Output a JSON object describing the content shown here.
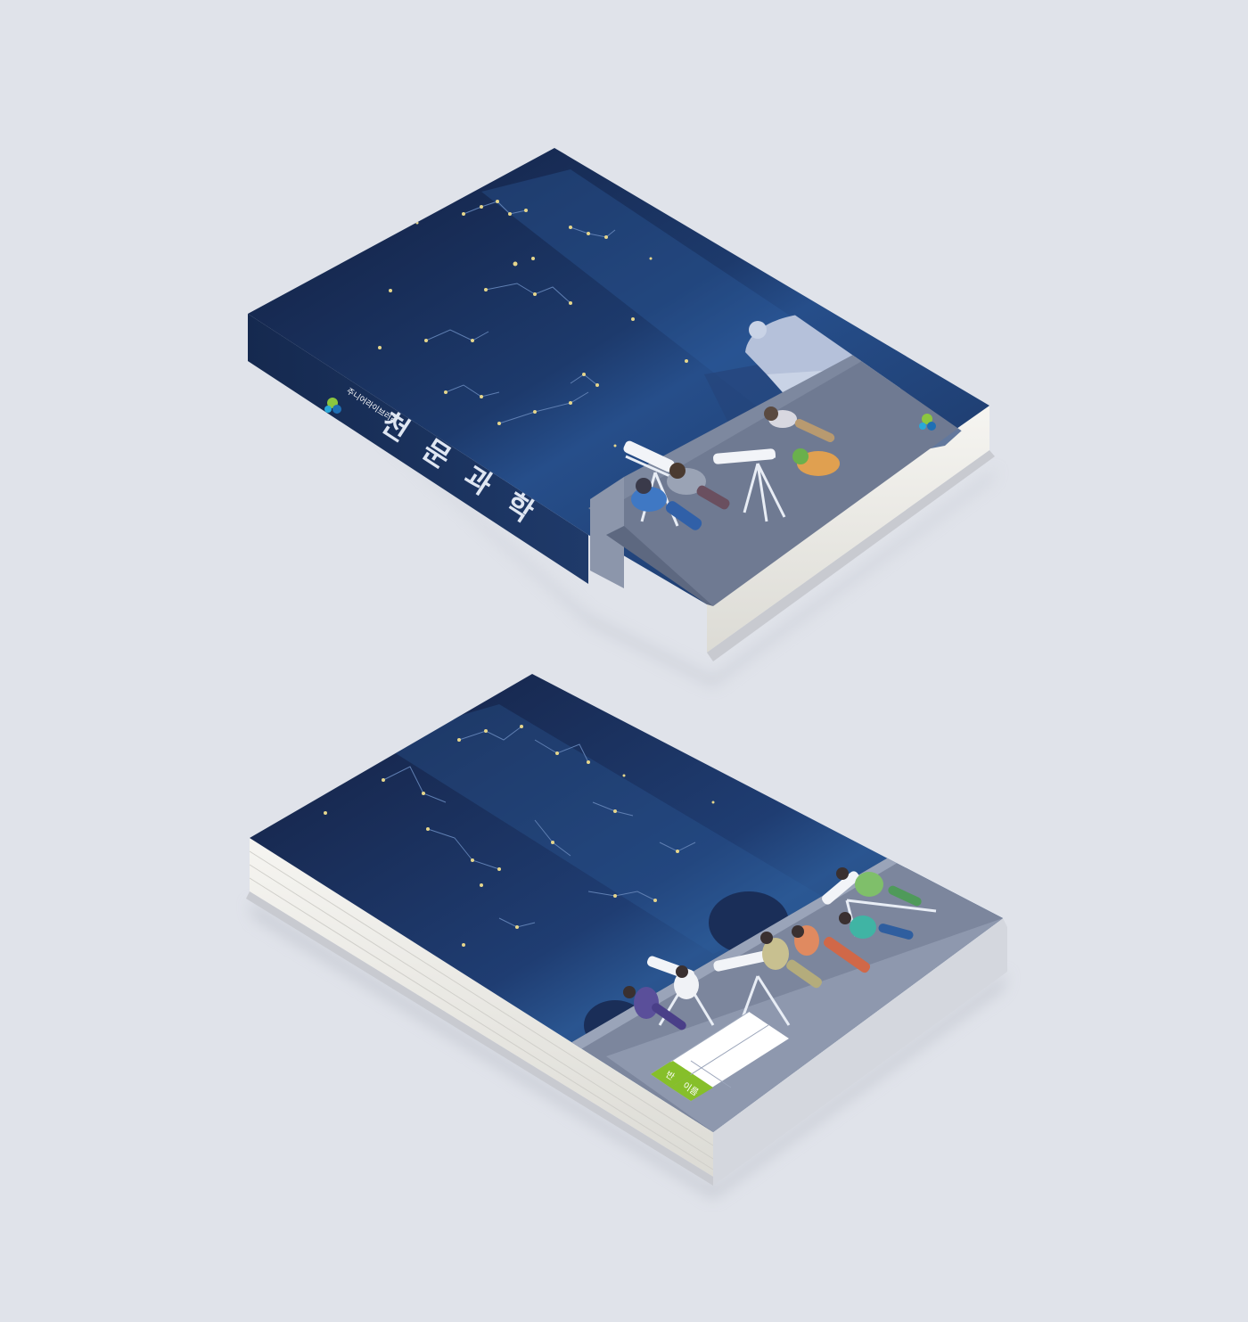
{
  "scene": {
    "background_color": "#e0e3ea",
    "colors": {
      "sky_dark": "#121e3f",
      "sky_mid": "#1e3d72",
      "milky_way": "#2c5c9a",
      "spine": "#1a3260",
      "platform": "#8c96ab",
      "platform_front": "#a6b0c4",
      "page_block": "#f4f3ef",
      "star": "#e6d68c",
      "constellation_line": "#5f7fb2",
      "label_green": "#86bf2a"
    }
  },
  "book_top": {
    "spine_title": "천문과학",
    "spine_logo_text": "주니어라이브러리",
    "cover_logo_text": "주니어라이브러리",
    "icons": [
      "observatory-dome-icon",
      "telescope-icon",
      "person-icon",
      "leaf-logo-icon"
    ]
  },
  "book_bottom": {
    "label_class": "반",
    "label_name": "이름",
    "icons": [
      "telescope-icon",
      "person-icon",
      "tree-silhouette-icon"
    ]
  }
}
